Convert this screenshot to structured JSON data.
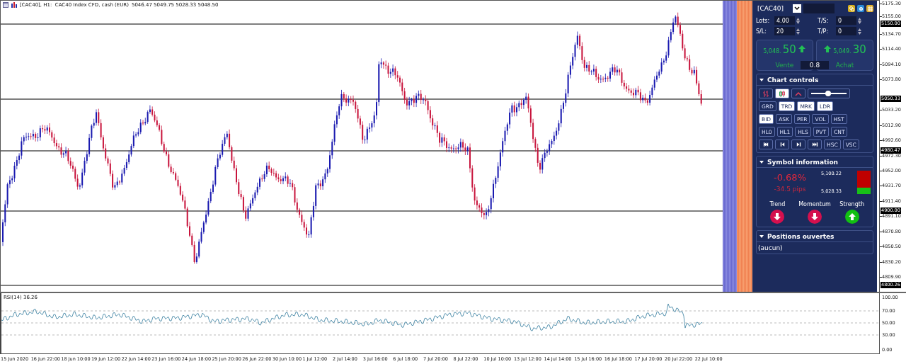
{
  "header": {
    "title": "[CAC40], H1:  CAC40 Index CFD, cash (EUR)",
    "ohlc": "5046.47 5049.75 5028.33 5048.50"
  },
  "price_axis": {
    "ticks": [
      "5175.30",
      "5155.00",
      "5134.70",
      "5114.40",
      "5094.10",
      "5073.80",
      "5033.20",
      "5012.90",
      "4992.60",
      "4972.30",
      "4952.00",
      "4931.70",
      "4911.40",
      "4891.10",
      "4870.80",
      "4850.50",
      "4830.20",
      "4809.90"
    ],
    "levels": [
      "5150.00",
      "5050.33",
      "4980.47",
      "4900.00",
      "4800.26"
    ]
  },
  "panel": {
    "symbol": "[CAC40]",
    "fields": [
      {
        "label": "Lots:",
        "value": "4.00"
      },
      {
        "label": "T/S:",
        "value": "0"
      },
      {
        "label": "S/L:",
        "value": "20"
      },
      {
        "label": "T/P:",
        "value": "0"
      }
    ],
    "sell": {
      "price_small": "5,048.",
      "price_big": "50",
      "label": "Vente"
    },
    "buy": {
      "price_small": "5,049.",
      "price_big": "30",
      "label": "Achat"
    },
    "spread": "0.8",
    "chart_controls": {
      "title": "Chart controls",
      "expanded": true,
      "zoom": {
        "level": 0.45
      },
      "icon_buttons": [
        {
          "kind": "bars",
          "selected": false
        },
        {
          "kind": "candles",
          "selected": true
        },
        {
          "kind": "line",
          "selected": false
        }
      ],
      "button_rows": [
        [
          {
            "label": "GRD",
            "selected": false
          },
          {
            "label": "TRD",
            "selected": true
          },
          {
            "label": "MRK",
            "selected": true
          },
          {
            "label": "LDR",
            "selected": true
          }
        ],
        [
          {
            "label": "BID",
            "selected": true
          },
          {
            "label": "ASK",
            "selected": false
          },
          {
            "label": "PER",
            "selected": false
          },
          {
            "label": "VOL",
            "selected": false
          },
          {
            "label": "HST",
            "selected": false
          }
        ],
        [
          {
            "label": "HL0",
            "selected": false
          },
          {
            "label": "HL1",
            "selected": false
          },
          {
            "label": "HLS",
            "selected": false
          },
          {
            "label": "PVT",
            "selected": false
          },
          {
            "label": "CNT",
            "selected": false
          }
        ]
      ],
      "nav_buttons": [
        {
          "kind": "first"
        },
        {
          "kind": "prev"
        },
        {
          "kind": "next"
        },
        {
          "kind": "last"
        },
        {
          "kind": "text",
          "label": "HSC"
        },
        {
          "kind": "text",
          "label": "VSC"
        }
      ]
    },
    "symbol_info": {
      "title": "Symbol information",
      "expanded": true,
      "change_percent": "-0.68%",
      "change_pips": "-34.5 pips",
      "high": "5,100.22",
      "low": "5,028.33",
      "indicators": [
        {
          "label": "Trend",
          "kind": "down",
          "color": "#d5104e"
        },
        {
          "label": "Momentum",
          "kind": "down",
          "color": "#d5104e"
        },
        {
          "label": "Strength",
          "kind": "up",
          "color": "#12c012"
        }
      ]
    },
    "positions": {
      "title": "Positions ouvertes",
      "expanded": true,
      "empty_text": "(aucun)"
    }
  },
  "rsi": {
    "label": "RSI(14) 36.26",
    "ticks": [
      "100.00",
      "70.00",
      "50.00",
      "30.00",
      "0.00"
    ]
  },
  "time_axis": [
    "15 Jun 2020",
    "16 Jun 22:00",
    "18 Jun 10:00",
    "19 Jun 12:00",
    "22 Jun 14:00",
    "23 Jun 16:00",
    "24 Jun 18:00",
    "25 Jun 20:00",
    "26 Jun 22:00",
    "30 Jun 10:00",
    "1 Jul 12:00",
    "2 Jul 14:00",
    "3 Jul 16:00",
    "6 Jul 18:00",
    "7 Jul 20:00",
    "8 Jul 22:00",
    "10 Jul 10:00",
    "13 Jul 12:00",
    "14 Jul 14:00",
    "15 Jul 16:00",
    "16 Jul 18:00",
    "17 Jul 20:00",
    "20 Jul 22:00",
    "22 Jul 10:00"
  ]
}
